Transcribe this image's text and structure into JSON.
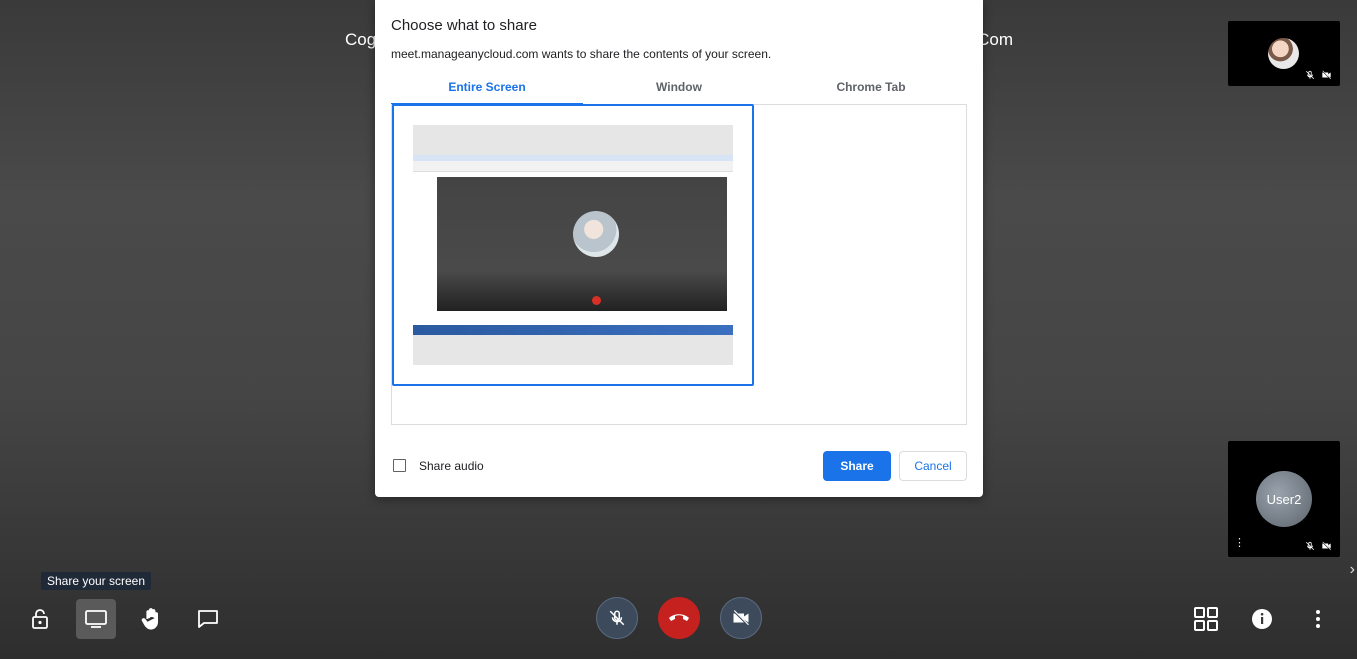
{
  "meeting": {
    "title_left": "Cog",
    "title_right": "Com"
  },
  "dialog": {
    "title": "Choose what to share",
    "subtitle": "meet.manageanycloud.com wants to share the contents of your screen.",
    "tabs": [
      {
        "label": "Entire Screen",
        "active": true
      },
      {
        "label": "Window",
        "active": false
      },
      {
        "label": "Chrome Tab",
        "active": false
      }
    ],
    "share_audio_label": "Share audio",
    "share_audio_checked": false,
    "share_button": "Share",
    "cancel_button": "Cancel"
  },
  "participants": [
    {
      "name": "",
      "muted": true,
      "video_off": true
    },
    {
      "name": "User2",
      "muted": true,
      "video_off": true
    }
  ],
  "toolbar": {
    "tooltip": "Share your screen"
  },
  "colors": {
    "accent": "#1a73e8",
    "hangup": "#c5221f",
    "background": "#454545"
  }
}
